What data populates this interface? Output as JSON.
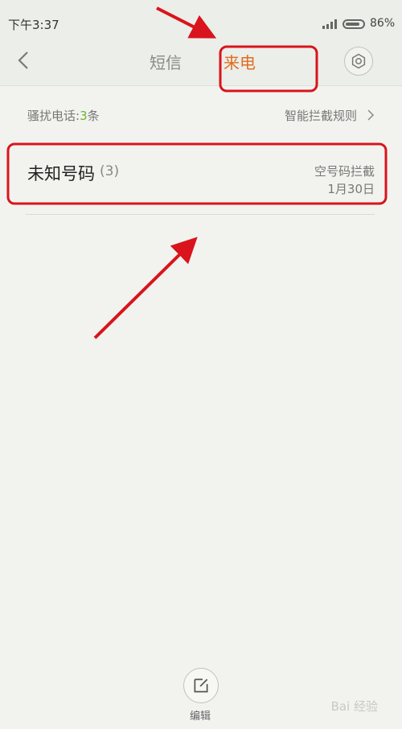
{
  "status_bar": {
    "time": "下午3:37",
    "battery": "86%",
    "battery_level": 0.86
  },
  "header": {
    "tabs": [
      {
        "label": "短信"
      },
      {
        "label": "来电"
      }
    ]
  },
  "summary": {
    "prefix": "骚扰电话:",
    "count": "3",
    "suffix": "条",
    "rules_link": "智能拦截规则"
  },
  "call_log": [
    {
      "name": "未知号码",
      "count": "(3)",
      "reason": "空号码拦截",
      "date": "1月30日"
    }
  ],
  "footer": {
    "edit_label": "编辑"
  },
  "watermark": "Bai 经验",
  "colors": {
    "active_tab": "#e06d20",
    "count_green": "#6bb32d",
    "annotation_red": "#d9141c"
  },
  "icons": [
    "back-chevron-icon",
    "settings-gear-icon",
    "chevron-right-icon",
    "edit-icon",
    "signal-icon",
    "battery-icon"
  ]
}
